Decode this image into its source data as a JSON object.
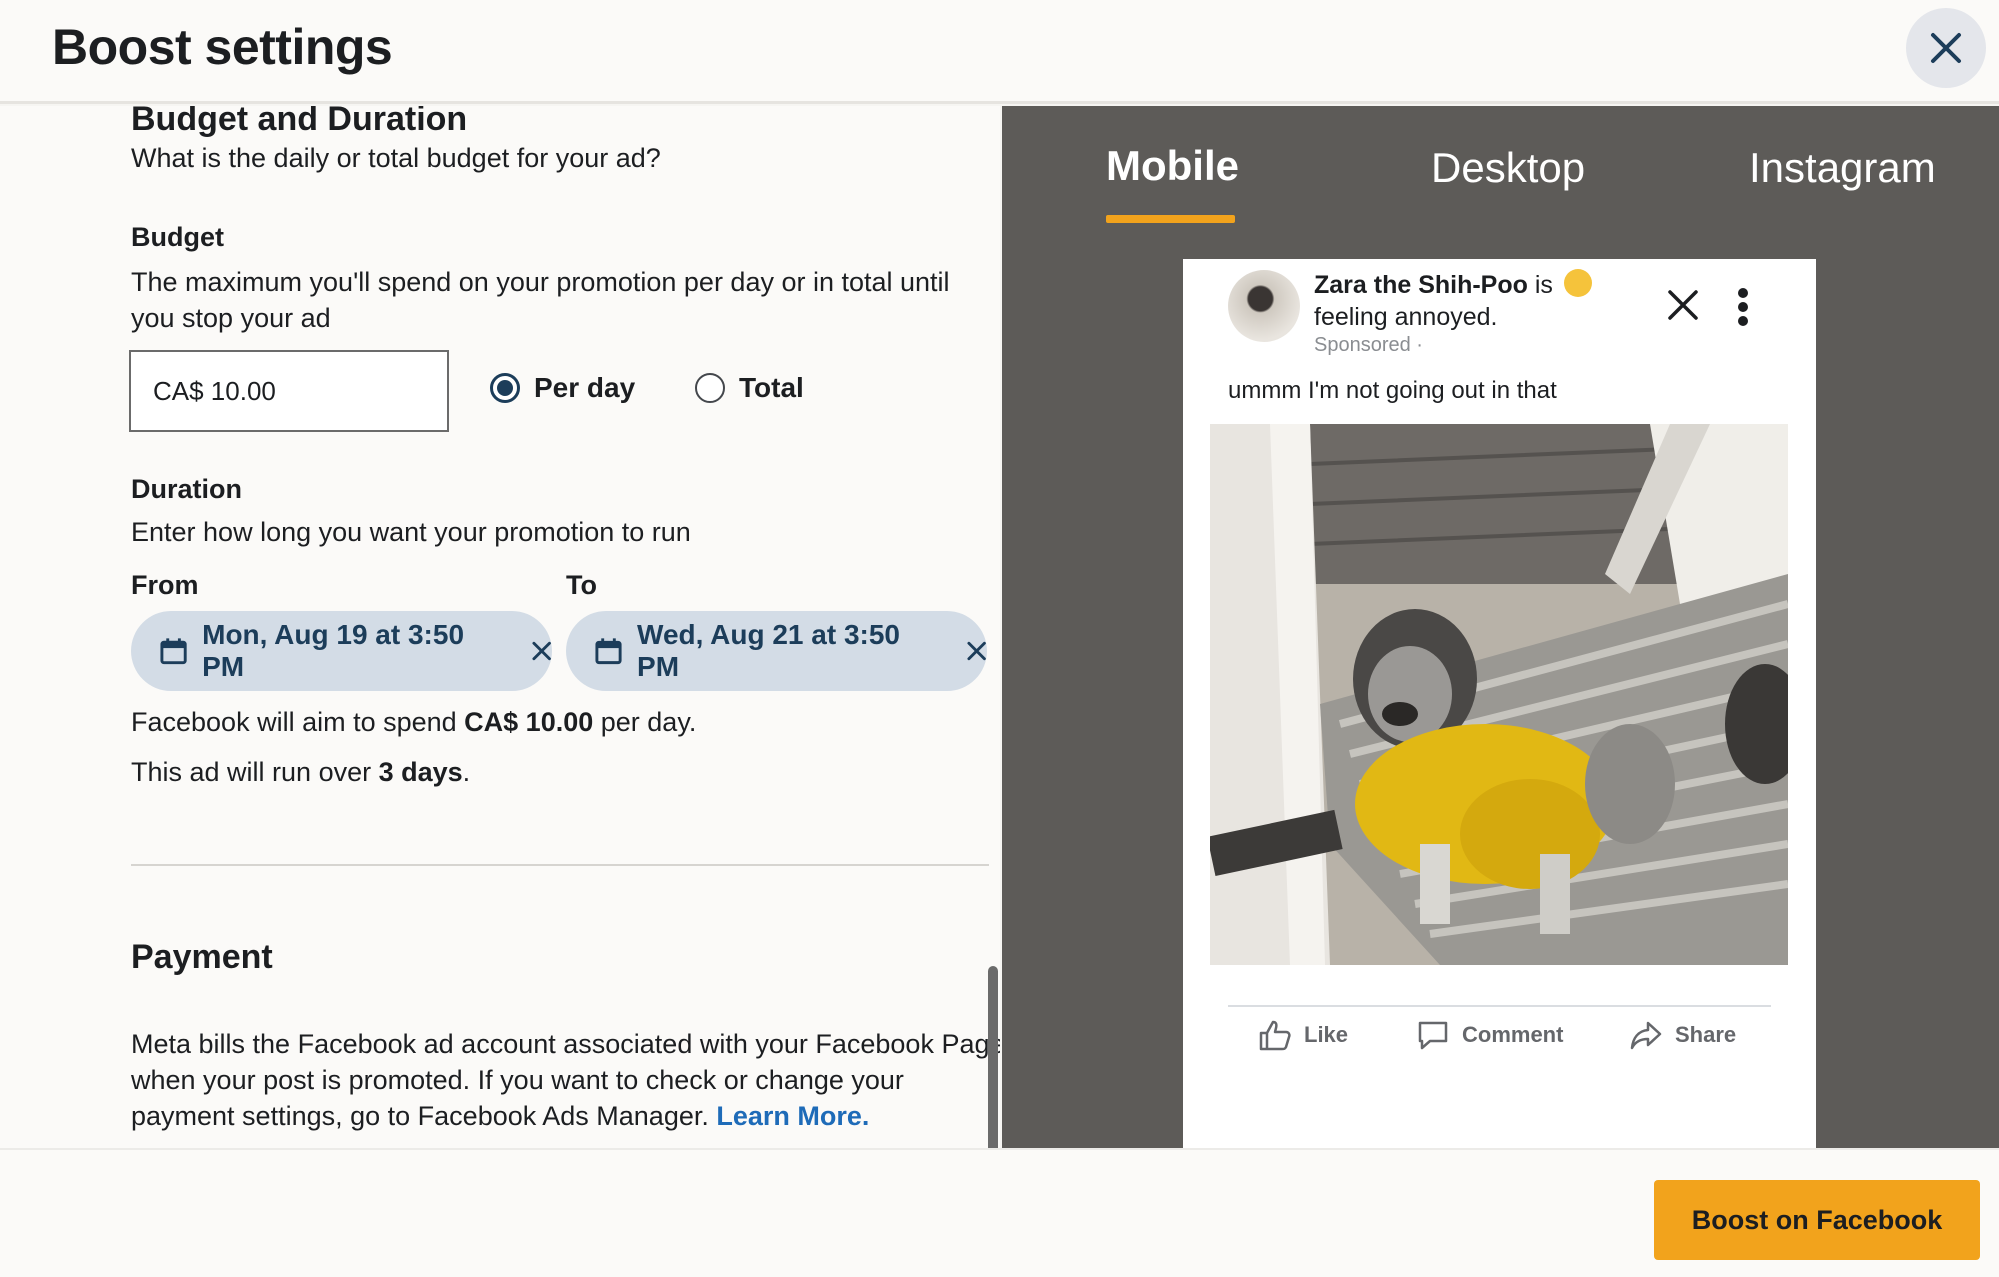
{
  "header": {
    "title": "Boost settings"
  },
  "budget_section": {
    "title": "Budget and Duration",
    "subtitle": "What is the daily or total budget for your ad?",
    "budget_label": "Budget",
    "budget_desc_line1": "The maximum you'll spend on your promotion per day or in total until",
    "budget_desc_line2": "you stop your ad",
    "budget_value": "CA$ 10.00",
    "options": [
      {
        "label": "Per day",
        "selected": true
      },
      {
        "label": "Total",
        "selected": false
      }
    ],
    "duration_label": "Duration",
    "duration_desc": "Enter how long you want your promotion to run",
    "from_label": "From",
    "to_label": "To",
    "from_value": "Mon, Aug 19 at 3:50 PM",
    "to_value": "Wed, Aug 21 at 3:50 PM",
    "spend_prefix": "Facebook will aim to spend ",
    "spend_amount": "CA$ 10.00",
    "spend_suffix": " per day.",
    "run_prefix": "This ad will run over ",
    "run_days": "3 days",
    "run_suffix": "."
  },
  "payment_section": {
    "title": "Payment",
    "line1": "Meta bills the Facebook ad account associated with your Facebook Page",
    "line2": "when your post is promoted. If you want to check or change your",
    "line3": "payment settings, go to Facebook Ads Manager. ",
    "learn_more": "Learn More."
  },
  "preview": {
    "tabs": [
      {
        "label": "Mobile",
        "active": true
      },
      {
        "label": "Desktop",
        "active": false
      },
      {
        "label": "Instagram",
        "active": false
      }
    ],
    "post": {
      "page_name": "Zara the Shih-Poo",
      "is_word": " is ",
      "feeling": "feeling annoyed.",
      "sponsored": "Sponsored ·",
      "text": "ummm I'm not going out in that",
      "actions": [
        "Like",
        "Comment",
        "Share"
      ]
    }
  },
  "footer": {
    "boost_label": "Boost on Facebook"
  },
  "colors": {
    "accent": "#f2a31c",
    "chip_bg": "#d3dce6",
    "chip_text": "#1c3d5a",
    "link": "#1e6bb8",
    "preview_bg": "#5d5b58"
  }
}
